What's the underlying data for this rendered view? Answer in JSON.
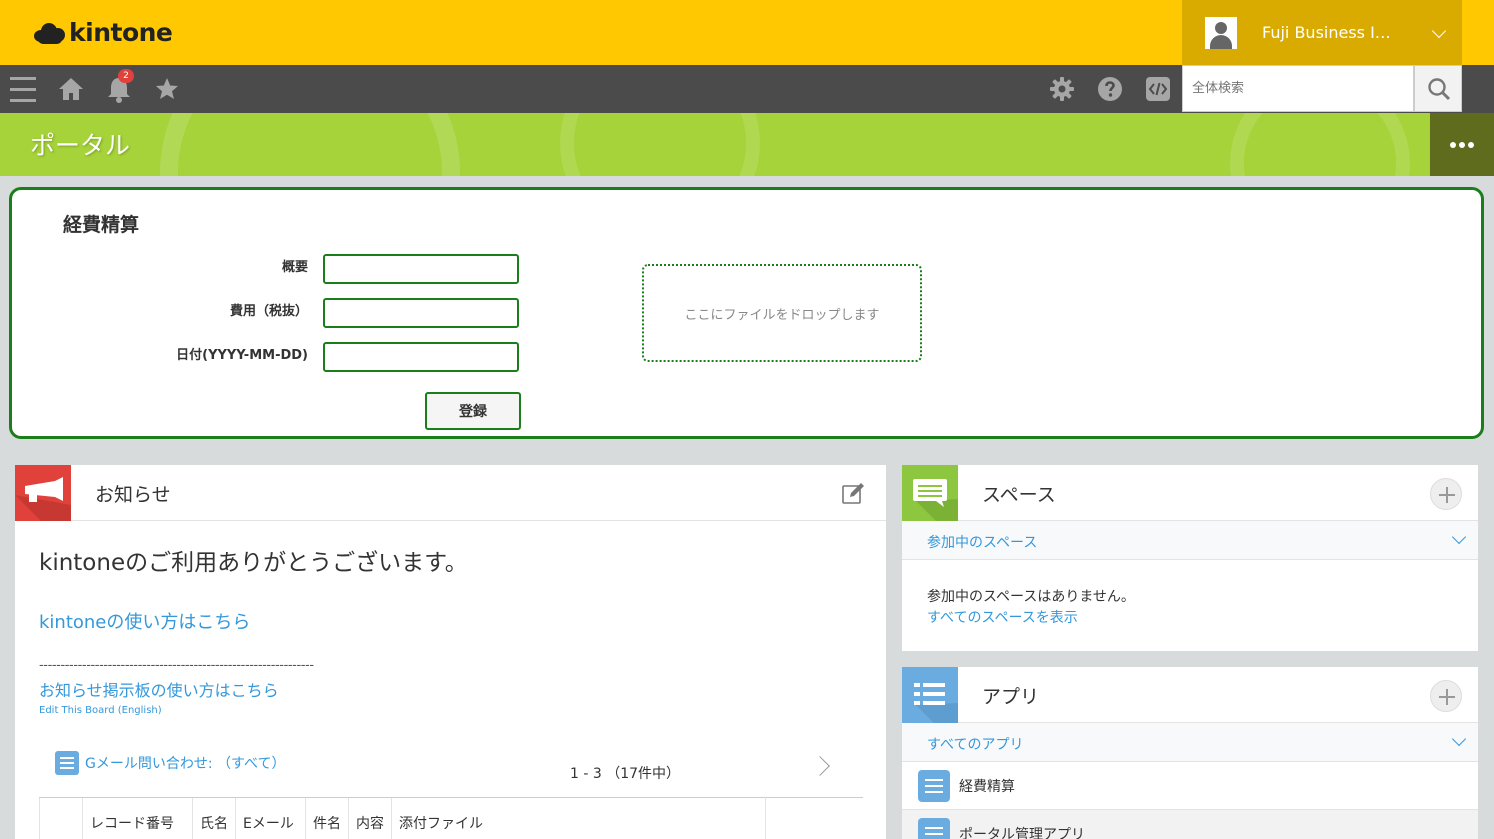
{
  "header": {
    "logo_text": "kintone",
    "user_name": "Fuji Business I…",
    "notification_count": "2",
    "search_placeholder": "全体検索"
  },
  "portal": {
    "title": "ポータル"
  },
  "expense_form": {
    "title": "経費精算",
    "fields": [
      {
        "label": "概要",
        "value": ""
      },
      {
        "label": "費用（税抜）",
        "value": ""
      },
      {
        "label": "日付(YYYY-MM-DD)",
        "value": ""
      }
    ],
    "drop_zone_text": "ここにファイルをドロップします",
    "submit_label": "登録"
  },
  "notice": {
    "title": "お知らせ",
    "heading": "kintoneのご利用ありがとうございます。",
    "link_howto": "kintoneの使い方はこちら",
    "separator": "----------------------------------------------------------------",
    "link_board": "お知らせ掲示板の使い方はこちら",
    "link_edit": "Edit This Board (English)",
    "view_name": "Gメール問い合わせ: （すべて）",
    "pager": "1 - 3 （17件中）",
    "table_columns": [
      "",
      "レコード番号",
      "氏名",
      "Eメール",
      "件名",
      "内容",
      "添付ファイル"
    ]
  },
  "space_panel": {
    "title": "スペース",
    "filter_label": "参加中のスペース",
    "empty_text": "参加中のスペースはありません。",
    "show_all_link": "すべてのスペースを表示"
  },
  "app_panel": {
    "title": "アプリ",
    "filter_label": "すべてのアプリ",
    "apps": [
      "経費精算",
      "ポータル管理アプリ"
    ]
  },
  "colors": {
    "header_yellow": "#ffc800",
    "nav_dark": "#4b4b4b",
    "portal_green": "#a5d339",
    "form_border_green": "#1a7f1a",
    "link_blue": "#3498db",
    "notice_red": "#e0413b",
    "space_green": "#8dc63f",
    "app_blue": "#6aace0"
  }
}
